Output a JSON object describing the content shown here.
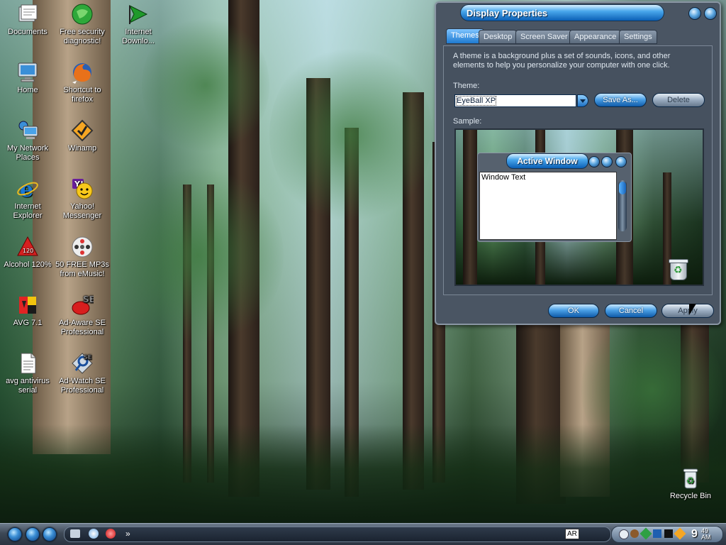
{
  "desktop": {
    "icons": [
      {
        "label": "Documents",
        "icon": "documents-icon"
      },
      {
        "label": "Free security diagnostic!",
        "icon": "security-globe-icon"
      },
      {
        "label": "Internet Downlo...",
        "icon": "download-arrow-icon"
      },
      {
        "label": "Home",
        "icon": "monitor-icon"
      },
      {
        "label": "Shortcut to firefox",
        "icon": "firefox-icon"
      },
      {
        "label": "My Network Places",
        "icon": "network-icon"
      },
      {
        "label": "Winamp",
        "icon": "winamp-icon"
      },
      {
        "label": "Internet Explorer",
        "icon": "internet-explorer-icon"
      },
      {
        "label": "Yahoo! Messenger",
        "icon": "yahoo-messenger-icon"
      },
      {
        "label": "Alcohol 120%",
        "icon": "alcohol-icon"
      },
      {
        "label": "50 FREE MP3s from eMusic!",
        "icon": "emusic-icon"
      },
      {
        "label": "AVG 7.1",
        "icon": "avg-icon"
      },
      {
        "label": "Ad-Aware SE Professional",
        "icon": "adaware-icon"
      },
      {
        "label": "avg antivirus serial",
        "icon": "text-file-icon"
      },
      {
        "label": "Ad-Watch SE Professional",
        "icon": "adwatch-icon"
      },
      {
        "label": "Recycle Bin",
        "icon": "recycle-bin-icon"
      }
    ]
  },
  "window": {
    "title": "Display Properties",
    "tabs": [
      "Themes",
      "Desktop",
      "Screen Saver",
      "Appearance",
      "Settings"
    ],
    "active_tab": "Themes",
    "description": "A theme is a background plus a set of sounds, icons, and other elements to help you personalize your computer with one click.",
    "theme_label": "Theme:",
    "theme_value": "EyeBall XP",
    "save_as_label": "Save As...",
    "delete_label": "Delete",
    "sample_label": "Sample:",
    "sample_window_title": "Active Window",
    "sample_window_text": "Window Text",
    "ok_label": "OK",
    "cancel_label": "Cancel",
    "apply_label": "Apply"
  },
  "taskbar": {
    "overflow_label": "»",
    "language": "AR",
    "clock_hour": "9",
    "clock_minutes": "49",
    "clock_ampm": "AM"
  }
}
